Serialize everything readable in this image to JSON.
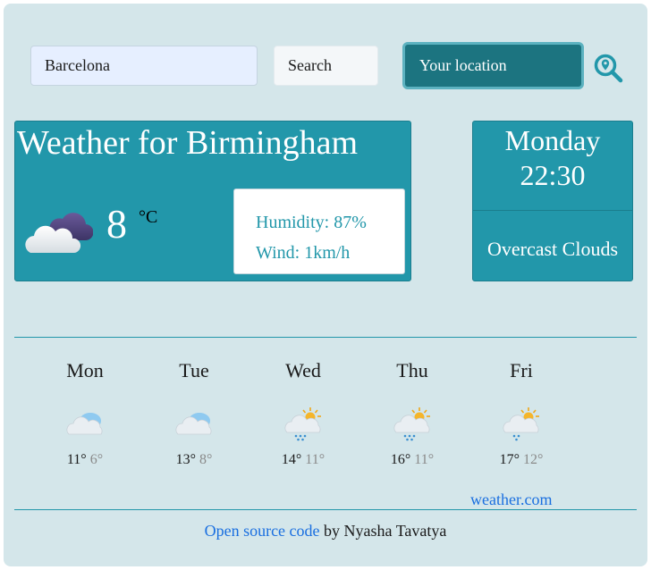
{
  "search": {
    "value": "Barcelona",
    "button_label": "Search",
    "location_label": "Your location",
    "icon": "search-location-icon"
  },
  "current": {
    "title": "Weather for Birmingham",
    "temperature": "8",
    "unit": "°C",
    "humidity": "Humidity: 87%",
    "wind": "Wind: 1km/h",
    "icon": "overcast-clouds-icon"
  },
  "side": {
    "day": "Monday",
    "time": "22:30",
    "condition": "Overcast Clouds"
  },
  "forecast": [
    {
      "day": "Mon",
      "max": "11°",
      "min": "6°",
      "icon": "cloud-sun-icon"
    },
    {
      "day": "Tue",
      "max": "13°",
      "min": "8°",
      "icon": "cloud-sun-icon"
    },
    {
      "day": "Wed",
      "max": "14°",
      "min": "11°",
      "icon": "sun-rain-icon"
    },
    {
      "day": "Thu",
      "max": "16°",
      "min": "11°",
      "icon": "sun-rain-icon"
    },
    {
      "day": "Fri",
      "max": "17°",
      "min": "12°",
      "icon": "sun-rain-icon"
    }
  ],
  "links": {
    "weather": "weather.com"
  },
  "footer": {
    "link_text": "Open source code",
    "suffix": " by Nyasha Tavatya"
  },
  "colors": {
    "accent": "#2297aa",
    "background": "#d4e6ea",
    "location_button": "#1c7480",
    "link": "#1a6fe0"
  }
}
